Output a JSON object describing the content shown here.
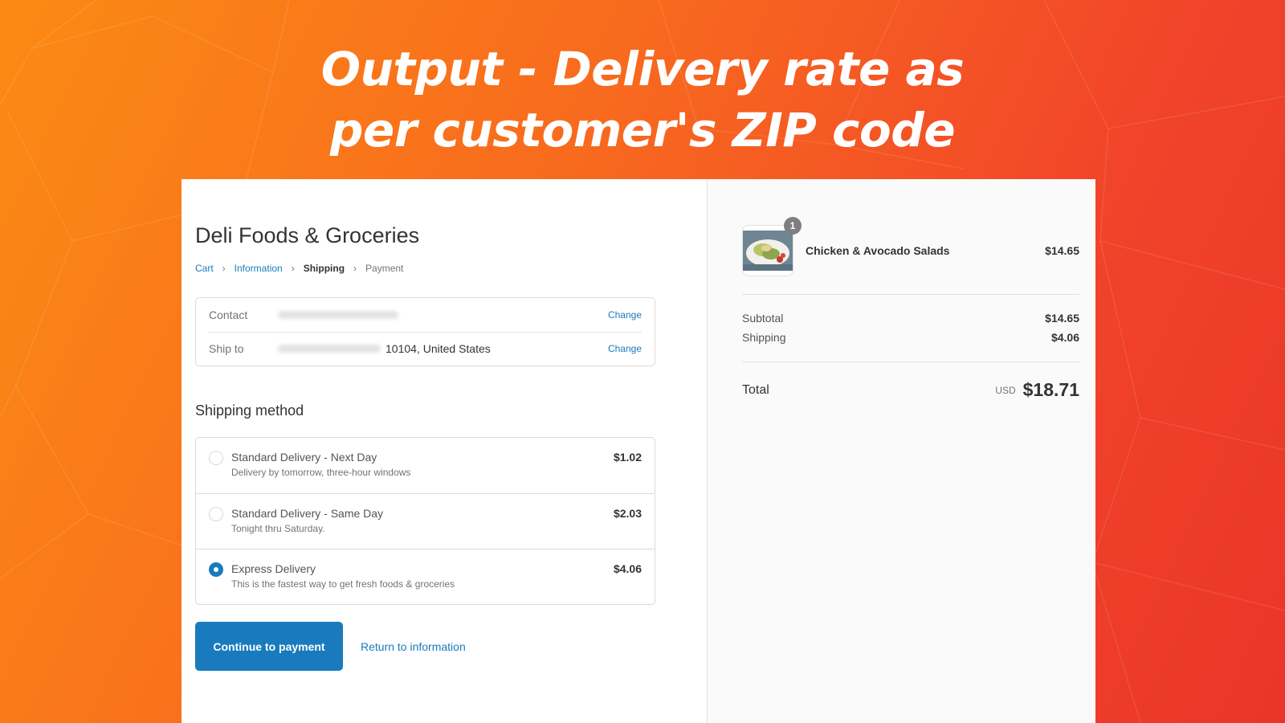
{
  "headline": {
    "line1": "Output - Delivery rate as",
    "line2": "per customer's ZIP code"
  },
  "store": {
    "name": "Deli Foods & Groceries"
  },
  "breadcrumb": {
    "items": [
      "Cart",
      "Information",
      "Shipping",
      "Payment"
    ],
    "current": "Shipping"
  },
  "review": {
    "contact_label": "Contact",
    "ship_to_label": "Ship to",
    "ship_to_value": "10104, United States",
    "change_label": "Change"
  },
  "shipping": {
    "title": "Shipping method",
    "methods": [
      {
        "title": "Standard Delivery - Next Day",
        "subtitle": "Delivery by tomorrow, three-hour windows",
        "price": "$1.02",
        "selected": false
      },
      {
        "title": "Standard Delivery - Same Day",
        "subtitle": "Tonight thru Saturday.",
        "price": "$2.03",
        "selected": false
      },
      {
        "title": "Express Delivery",
        "subtitle": "This is the fastest way to get fresh foods & groceries",
        "price": "$4.06",
        "selected": true
      }
    ]
  },
  "actions": {
    "continue_label": "Continue to payment",
    "return_label": "Return to information"
  },
  "order": {
    "product": {
      "name": "Chicken & Avocado Salads",
      "price": "$14.65",
      "quantity": "1"
    },
    "subtotal_label": "Subtotal",
    "subtotal": "$14.65",
    "shipping_label": "Shipping",
    "shipping": "$4.06",
    "total_label": "Total",
    "currency": "USD",
    "total": "$18.71"
  },
  "colors": {
    "accent": "#197bbd",
    "bg_start": "#fb8b14",
    "bg_end": "#ea3528"
  }
}
